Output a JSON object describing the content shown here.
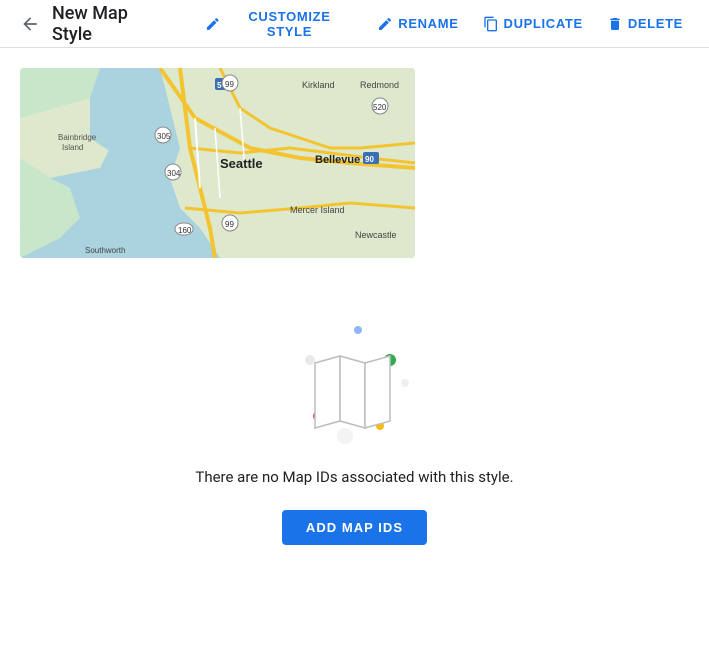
{
  "header": {
    "title": "New Map Style",
    "back_icon": "←",
    "actions": [
      {
        "key": "customize",
        "label": "CUSTOMIZE STYLE",
        "icon": "✏"
      },
      {
        "key": "rename",
        "label": "RENAME",
        "icon": "✏"
      },
      {
        "key": "duplicate",
        "label": "DUPLICATE",
        "icon": "⧉"
      },
      {
        "key": "delete",
        "label": "DELETE",
        "icon": "🗑"
      }
    ]
  },
  "empty_state": {
    "message": "There are no Map IDs associated with this style.",
    "add_button": "ADD MAP IDS"
  }
}
